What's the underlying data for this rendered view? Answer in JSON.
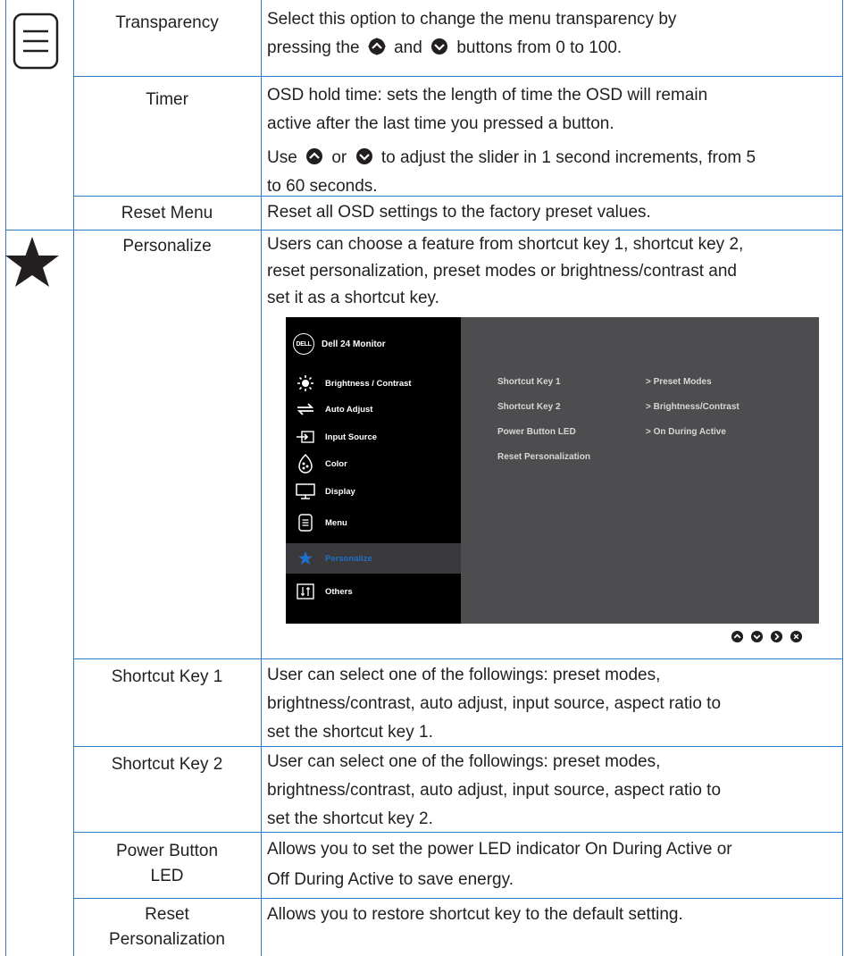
{
  "colors": {
    "rule": "#2e7bc4",
    "osd_bg": "#4d4d4f",
    "osd_menu": "#000000",
    "osd_active": "#1f6fc7"
  },
  "icons": {
    "menu_section": "menu-lines-icon",
    "personalize_section": "star-icon",
    "up_button": "up-arrow-button-icon",
    "down_button": "down-arrow-button-icon"
  },
  "rows": {
    "transparency": {
      "name": "Transparency",
      "desc_a": "Select this option to change the menu transparency by",
      "desc_b": "pressing the",
      "desc_c": "and",
      "desc_d": "buttons from 0 to 100."
    },
    "timer": {
      "name": "Timer",
      "desc_1": "OSD hold time: sets the length of time the OSD will remain",
      "desc_2": "active after the last time you pressed a button.",
      "desc_3a": "Use",
      "desc_3b": "or",
      "desc_3c": "to adjust the slider in 1 second increments, from 5",
      "desc_4": "to 60 seconds."
    },
    "reset_menu": {
      "name": "Reset Menu",
      "desc": "Reset all OSD settings to the factory preset values."
    },
    "personalize": {
      "name": "Personalize",
      "desc_1": "Users can choose a feature from shortcut key 1, shortcut key 2,",
      "desc_2": "reset personalization, preset modes or brightness/contrast and",
      "desc_3": "set it as a shortcut key."
    },
    "shortcut1": {
      "name": "Shortcut Key 1",
      "desc_1": "User can select one of the followings: preset modes,",
      "desc_2": "brightness/contrast, auto adjust, input source, aspect ratio to",
      "desc_3": "set the shortcut key 1."
    },
    "shortcut2": {
      "name": "Shortcut Key 2",
      "desc_1": "User can select one of the followings: preset modes,",
      "desc_2": "brightness/contrast, auto adjust, input source, aspect ratio to",
      "desc_3": "set the shortcut key 2."
    },
    "power_led": {
      "name_1": "Power Button",
      "name_2": "LED",
      "desc_1": "Allows you to set the power LED indicator On During Active or",
      "desc_2": "Off During Active to save energy."
    },
    "reset_personalization": {
      "name_1": "Reset",
      "name_2": "Personalization",
      "desc": "Allows you to restore shortcut key to the default setting."
    }
  },
  "osd": {
    "logo": "DELL",
    "title": "Dell 24 Monitor",
    "menu": [
      {
        "label": "Brightness / Contrast",
        "icon": "brightness-icon"
      },
      {
        "label": "Auto Adjust",
        "icon": "auto-adjust-icon"
      },
      {
        "label": "Input Source",
        "icon": "input-source-icon"
      },
      {
        "label": "Color",
        "icon": "color-icon"
      },
      {
        "label": "Display",
        "icon": "display-icon"
      },
      {
        "label": "Menu",
        "icon": "menu-icon"
      },
      {
        "label": "Personalize",
        "icon": "star-icon",
        "active": true
      },
      {
        "label": "Others",
        "icon": "others-icon"
      }
    ],
    "settings": [
      {
        "label": "Shortcut Key 1",
        "value": ">  Preset Modes"
      },
      {
        "label": "Shortcut Key 2",
        "value": ">  Brightness/Contrast"
      },
      {
        "label": "Power Button LED",
        "value": ">  On During Active"
      },
      {
        "label": "Reset Personalization",
        "value": ""
      }
    ],
    "nav_buttons": [
      "up-button-icon",
      "down-button-icon",
      "right-button-icon",
      "close-button-icon"
    ]
  }
}
